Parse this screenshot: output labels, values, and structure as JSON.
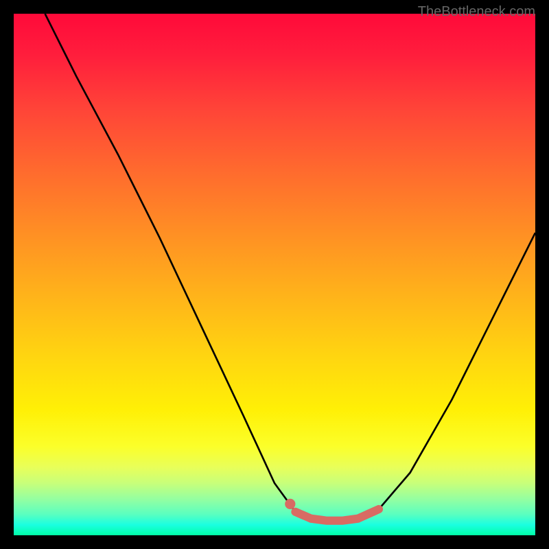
{
  "attribution": "TheBottleneck.com",
  "colors": {
    "curve_black": "#000000",
    "lowlight_coral": "#d86b63",
    "dot_coral": "#d86b63"
  },
  "chart_data": {
    "type": "line",
    "title": "",
    "xlabel": "",
    "ylabel": "",
    "xlim": [
      0,
      100
    ],
    "ylim": [
      0,
      100
    ],
    "grid": false,
    "legend": false,
    "series": [
      {
        "name": "main_curve",
        "x": [
          6,
          12,
          20,
          28,
          36,
          44,
          50,
          54,
          57,
          60,
          63,
          66,
          70,
          76,
          84,
          92,
          100
        ],
        "y": [
          100,
          88,
          73,
          57,
          40,
          23,
          10,
          4.5,
          3.2,
          2.8,
          2.8,
          3.2,
          5,
          12,
          26,
          42,
          58
        ],
        "color": "#000000"
      },
      {
        "name": "bottom_highlight",
        "x": [
          54,
          57,
          60,
          63,
          66,
          70
        ],
        "y": [
          4.5,
          3.2,
          2.8,
          2.8,
          3.2,
          5
        ],
        "color": "#d86b63"
      }
    ],
    "points": [
      {
        "name": "marker_dot",
        "x": 53,
        "y": 6,
        "color": "#d86b63"
      }
    ],
    "background_gradient": [
      {
        "stop": 0.0,
        "color": "#ff0a3a"
      },
      {
        "stop": 0.5,
        "color": "#ffb31a"
      },
      {
        "stop": 0.8,
        "color": "#fff006"
      },
      {
        "stop": 1.0,
        "color": "#00ffa7"
      }
    ]
  }
}
